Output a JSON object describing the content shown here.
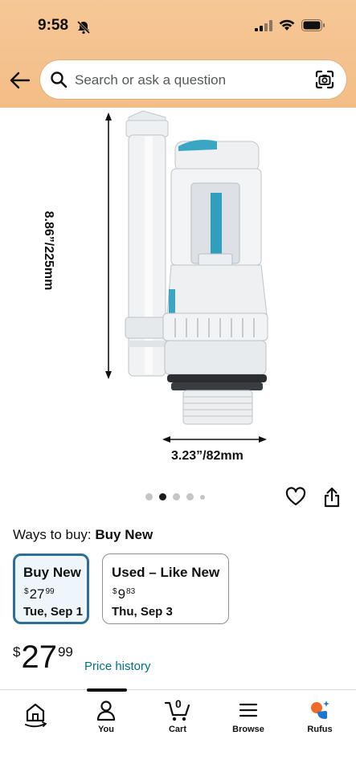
{
  "status_bar": {
    "time": "9:58"
  },
  "search": {
    "placeholder": "Search or ask a question"
  },
  "product_image": {
    "dimension_height": "8.86”/225mm",
    "dimension_width": "3.23”/82mm"
  },
  "carousel": {
    "count": 5,
    "active_index": 1
  },
  "ways_to_buy": {
    "label": "Ways to buy:",
    "selected": "Buy New"
  },
  "options": [
    {
      "title": "Buy New",
      "price_symbol": "$",
      "price_whole": "27",
      "price_fraction": "99",
      "delivery": "Tue, Sep 1"
    },
    {
      "title": "Used – Like New",
      "price_symbol": "$",
      "price_whole": "9",
      "price_fraction": "83",
      "delivery": "Thu, Sep 3"
    }
  ],
  "price": {
    "symbol": "$",
    "whole": "27",
    "fraction": "99",
    "history_link": "Price history"
  },
  "tabbar": {
    "cart_count": "0",
    "tabs": [
      {
        "label": "",
        "icon": "home-icon"
      },
      {
        "label": "You",
        "icon": "user-icon"
      },
      {
        "label": "Cart",
        "icon": "cart-icon"
      },
      {
        "label": "Browse",
        "icon": "menu-icon"
      },
      {
        "label": "Rufus",
        "icon": "rufus-icon"
      }
    ]
  },
  "colors": {
    "header": "#f5c491",
    "link": "#007185",
    "selected_border": "#2c6e99",
    "accent_blue": "#2a9dbd"
  }
}
